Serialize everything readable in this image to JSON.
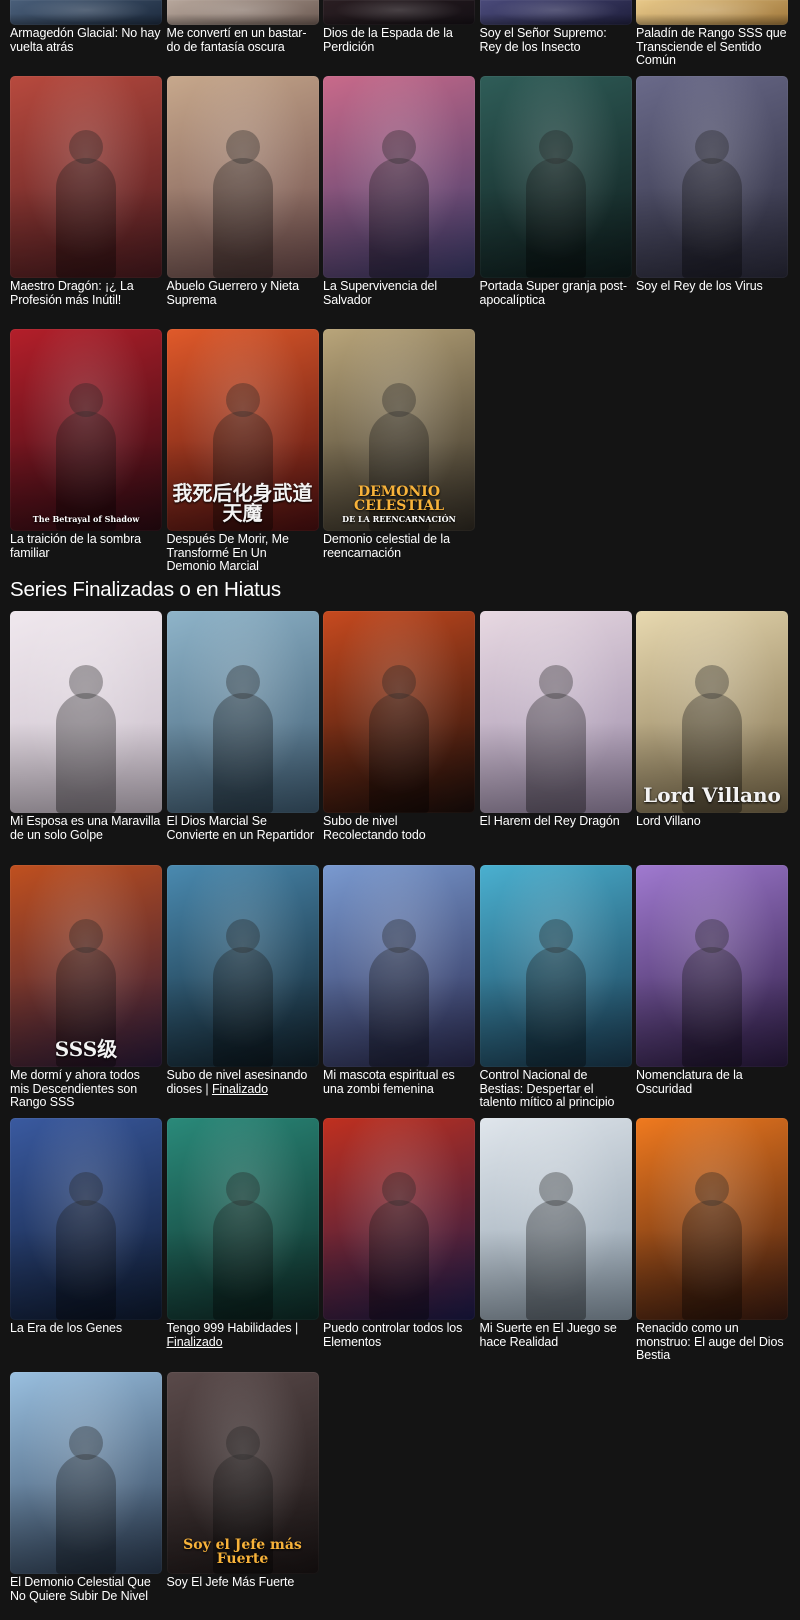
{
  "rows_top": [
    {
      "title": "Armagedón Glacial: No hay vuelta atrás",
      "colors": [
        "#4a5f7a",
        "#1c2a3d"
      ]
    },
    {
      "title": "Me convertí en un bastar-do de fantasía oscura",
      "colors": [
        "#b7a79c",
        "#6d5b53"
      ]
    },
    {
      "title": "Dios de la Espada de la Perdición",
      "colors": [
        "#2a1e22",
        "#151015"
      ]
    },
    {
      "title": "Soy el Señor Supremo: Rey de los Insecto",
      "colors": [
        "#4a4a7a",
        "#1f1f3d"
      ]
    },
    {
      "title": "Paladín de Rango SSS que Transciende el Sentido Común",
      "colors": [
        "#e8c98a",
        "#a0773a"
      ]
    }
  ],
  "rows_ongoing_2": [
    {
      "title": "Maestro Dragón: ¡¿ La Profesión más Inútil!",
      "colors": [
        "#b84a3e",
        "#4a1a1f"
      ]
    },
    {
      "title": "Abuelo Guerrero y Nieta Suprema",
      "colors": [
        "#c7a88c",
        "#6b4a4a"
      ]
    },
    {
      "title": "La Supervivencia del Salvador",
      "colors": [
        "#c96a8a",
        "#3a3a6a"
      ]
    },
    {
      "title": "Portada Super granja post-apocalíptica",
      "colors": [
        "#2f5d58",
        "#0e1c1c"
      ]
    },
    {
      "title": "Soy el Rey de los Virus",
      "colors": [
        "#6a6a8a",
        "#2a2a3a"
      ]
    }
  ],
  "rows_ongoing_3": [
    {
      "title": "La traición de la sombra familiar",
      "colors": [
        "#b41f2a",
        "#2a0a12"
      ],
      "cover_text": "",
      "cover_sub": "The Betrayal of Shadow"
    },
    {
      "title": "Después De Morir, Me Transformé En Un Demonio Marcial",
      "colors": [
        "#e05a2a",
        "#4a0e10"
      ],
      "cover_text": "我死后化身武道天魔"
    },
    {
      "title": "Demonio celestial de la reencarnación",
      "colors": [
        "#b9a57a",
        "#2f2a22"
      ],
      "cover_text": "DEMONIO CELESTIAL",
      "cover_sub": "DE LA REENCARNACIÓN"
    }
  ],
  "section": {
    "title": "Series Finalizadas o en Hiatus"
  },
  "finished_1": [
    {
      "title": "Mi Esposa es una Maravilla de un solo Golpe",
      "colors": [
        "#f0e8ee",
        "#c7bcc8"
      ]
    },
    {
      "title": "El Dios Marcial Se Convierte en un Repartidor",
      "colors": [
        "#8fb4c9",
        "#3d5a70"
      ]
    },
    {
      "title": "Subo de nivel Recolectando todo",
      "colors": [
        "#c74a1f",
        "#1a0d0a"
      ]
    },
    {
      "title": "El Harem del Rey Dragón",
      "colors": [
        "#e8d9e2",
        "#9a8aa8"
      ]
    },
    {
      "title": "Lord Villano",
      "colors": [
        "#e8d9b0",
        "#7a6a4a"
      ],
      "cover_text": "Lord Villano"
    }
  ],
  "finished_2": [
    {
      "title": "Me dormí y ahora todos mis Descendientes son Rango SSS",
      "colors": [
        "#c0501f",
        "#2a1a3a"
      ],
      "cover_text": "SSS级"
    },
    {
      "title": "Subo de nivel asesinando dioses",
      "status": "Finalizado",
      "colors": [
        "#4a8ab0",
        "#10202a"
      ]
    },
    {
      "title": "Mi mascota espiritual es una zombi femenina",
      "colors": [
        "#7a9ad0",
        "#2a2a50"
      ]
    },
    {
      "title": "Control Nacional de Bestias: Despertar el talento mítico al principio",
      "colors": [
        "#4ab0d0",
        "#1a3a50"
      ]
    },
    {
      "title": "Nomenclatura de la Oscuridad",
      "colors": [
        "#a07ad0",
        "#2a1a40"
      ]
    }
  ],
  "finished_3": [
    {
      "title": "La Era de los Genes",
      "colors": [
        "#3a5aa0",
        "#0e1a30"
      ]
    },
    {
      "title": "Tengo 999 Habilidades",
      "status": "Finalizado",
      "colors": [
        "#2a8a7a",
        "#0e2a26"
      ]
    },
    {
      "title": "Puedo controlar todos los Elementos",
      "colors": [
        "#c0301f",
        "#1a1a4a"
      ]
    },
    {
      "title": "Mi Suerte en El Juego se hace Realidad",
      "colors": [
        "#e0e6ec",
        "#8a9aa8"
      ]
    },
    {
      "title": "Renacido como un monstruo: El auge del Dios Bestia",
      "colors": [
        "#f07a1f",
        "#3a1a10"
      ]
    }
  ],
  "finished_4": [
    {
      "title": "El Demonio Celestial Que No Quiere Subir De Nivel",
      "colors": [
        "#9ac0e0",
        "#2a3a50"
      ]
    },
    {
      "title": "Soy El Jefe Más Fuerte",
      "colors": [
        "#5a4a4a",
        "#1a1414"
      ],
      "cover_text": "Soy el Jefe más Fuerte"
    }
  ]
}
